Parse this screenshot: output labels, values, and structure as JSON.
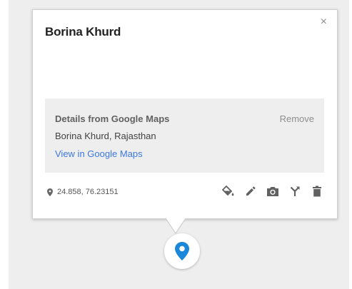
{
  "popup": {
    "title": "Borina Khurd",
    "close_label": "×",
    "details": {
      "heading": "Details from Google Maps",
      "remove_label": "Remove",
      "address": "Borina Khurd, Rajasthan",
      "link_label": "View in Google Maps"
    },
    "coordinates": "24.858, 76.23151",
    "tools": [
      "paint-bucket-icon",
      "pencil-icon",
      "camera-icon",
      "directions-icon",
      "trash-icon"
    ]
  },
  "marker": {
    "color": "#1a87d8"
  },
  "colors": {
    "link": "#3b78e7",
    "details_bg": "#eeeeee"
  }
}
